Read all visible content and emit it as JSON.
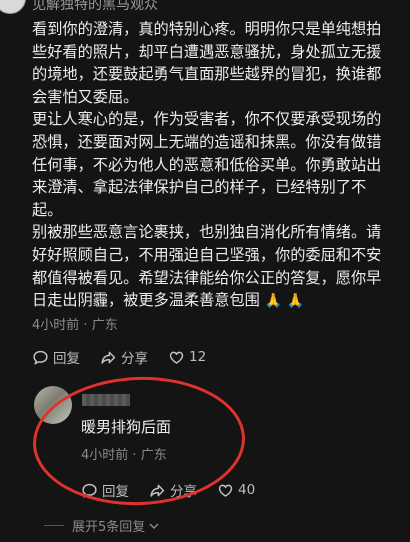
{
  "top_comment": {
    "username": "见解独特的黑马观众",
    "paragraphs": [
      "看到你的澄清，真的特别心疼。明明你只是单纯想拍些好看的照片，却平白遭遇恶意骚扰，身处孤立无援的境地，还要鼓起勇气直面那些越界的冒犯，换谁都会害怕又委屈。",
      "更让人寒心的是，作为受害者，你不仅要承受现场的恐惧，还要面对网上无端的造谣和抹黑。你没有做错任何事，不必为他人的恶意和低俗买单。你勇敢站出来澄清、拿起法律保护自己的样子，已经特别了不起。",
      "别被那些恶意言论裹挟，也别独自消化所有情绪。请好好照顾自己，不用强迫自己坚强，你的委屈和不安都值得被看见。希望法律能给你公正的答复，愿你早日走出阴霾，被更多温柔善意包围"
    ],
    "emoji": "🙏 🙏",
    "time": "4小时前",
    "location": "广东",
    "reply_label": "回复",
    "share_label": "分享",
    "like_count": "12"
  },
  "reply": {
    "text": "暖男排狗后面",
    "time": "4小时前",
    "location": "广东",
    "reply_label": "回复",
    "share_label": "分享",
    "like_count": "40"
  },
  "expand_label": "展开5条回复",
  "colors": {
    "background": "#141414",
    "annotation": "#e0322c"
  }
}
